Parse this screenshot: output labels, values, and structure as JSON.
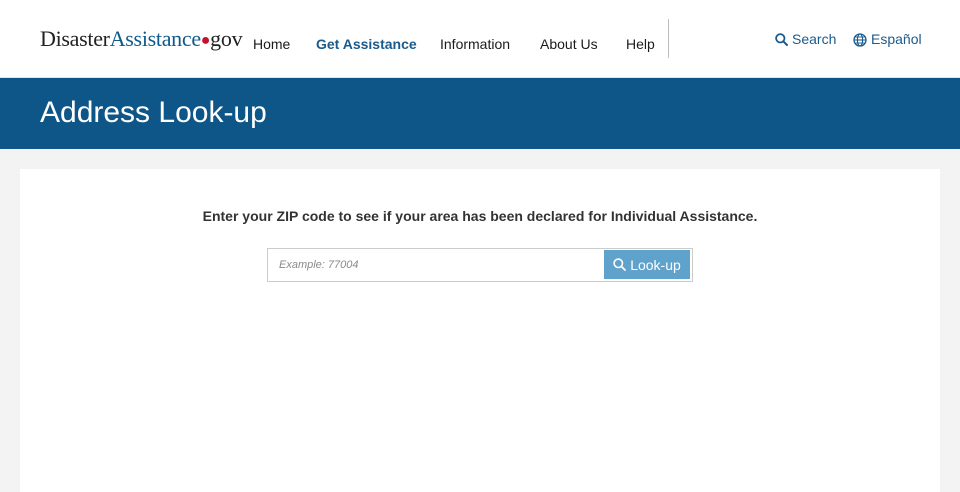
{
  "header": {
    "logo": {
      "part1": "Disaster",
      "part2": "Assistance",
      "dot": "●",
      "part3": "gov"
    },
    "nav": [
      {
        "label": "Home",
        "active": false
      },
      {
        "label": "Get Assistance",
        "active": true
      },
      {
        "label": "Information",
        "active": false
      },
      {
        "label": "About Us",
        "active": false
      },
      {
        "label": "Help",
        "active": false
      }
    ],
    "search_label": "Search",
    "search_icon": "search-icon",
    "language_label": "Español",
    "language_icon": "globe-icon"
  },
  "banner": {
    "title": "Address Look-up"
  },
  "lookup": {
    "instruction": "Enter your ZIP code to see if your area has been declared for Individual Assistance.",
    "zip_placeholder": "Example: 77004",
    "zip_value": "",
    "button_label": "Look-up",
    "button_icon": "search-icon"
  },
  "colors": {
    "brand_blue": "#0e5687",
    "link_blue": "#1b5a8c",
    "button_blue": "#5fa3cd",
    "logo_red": "#c8102e",
    "page_background": "#f3f3f3"
  }
}
